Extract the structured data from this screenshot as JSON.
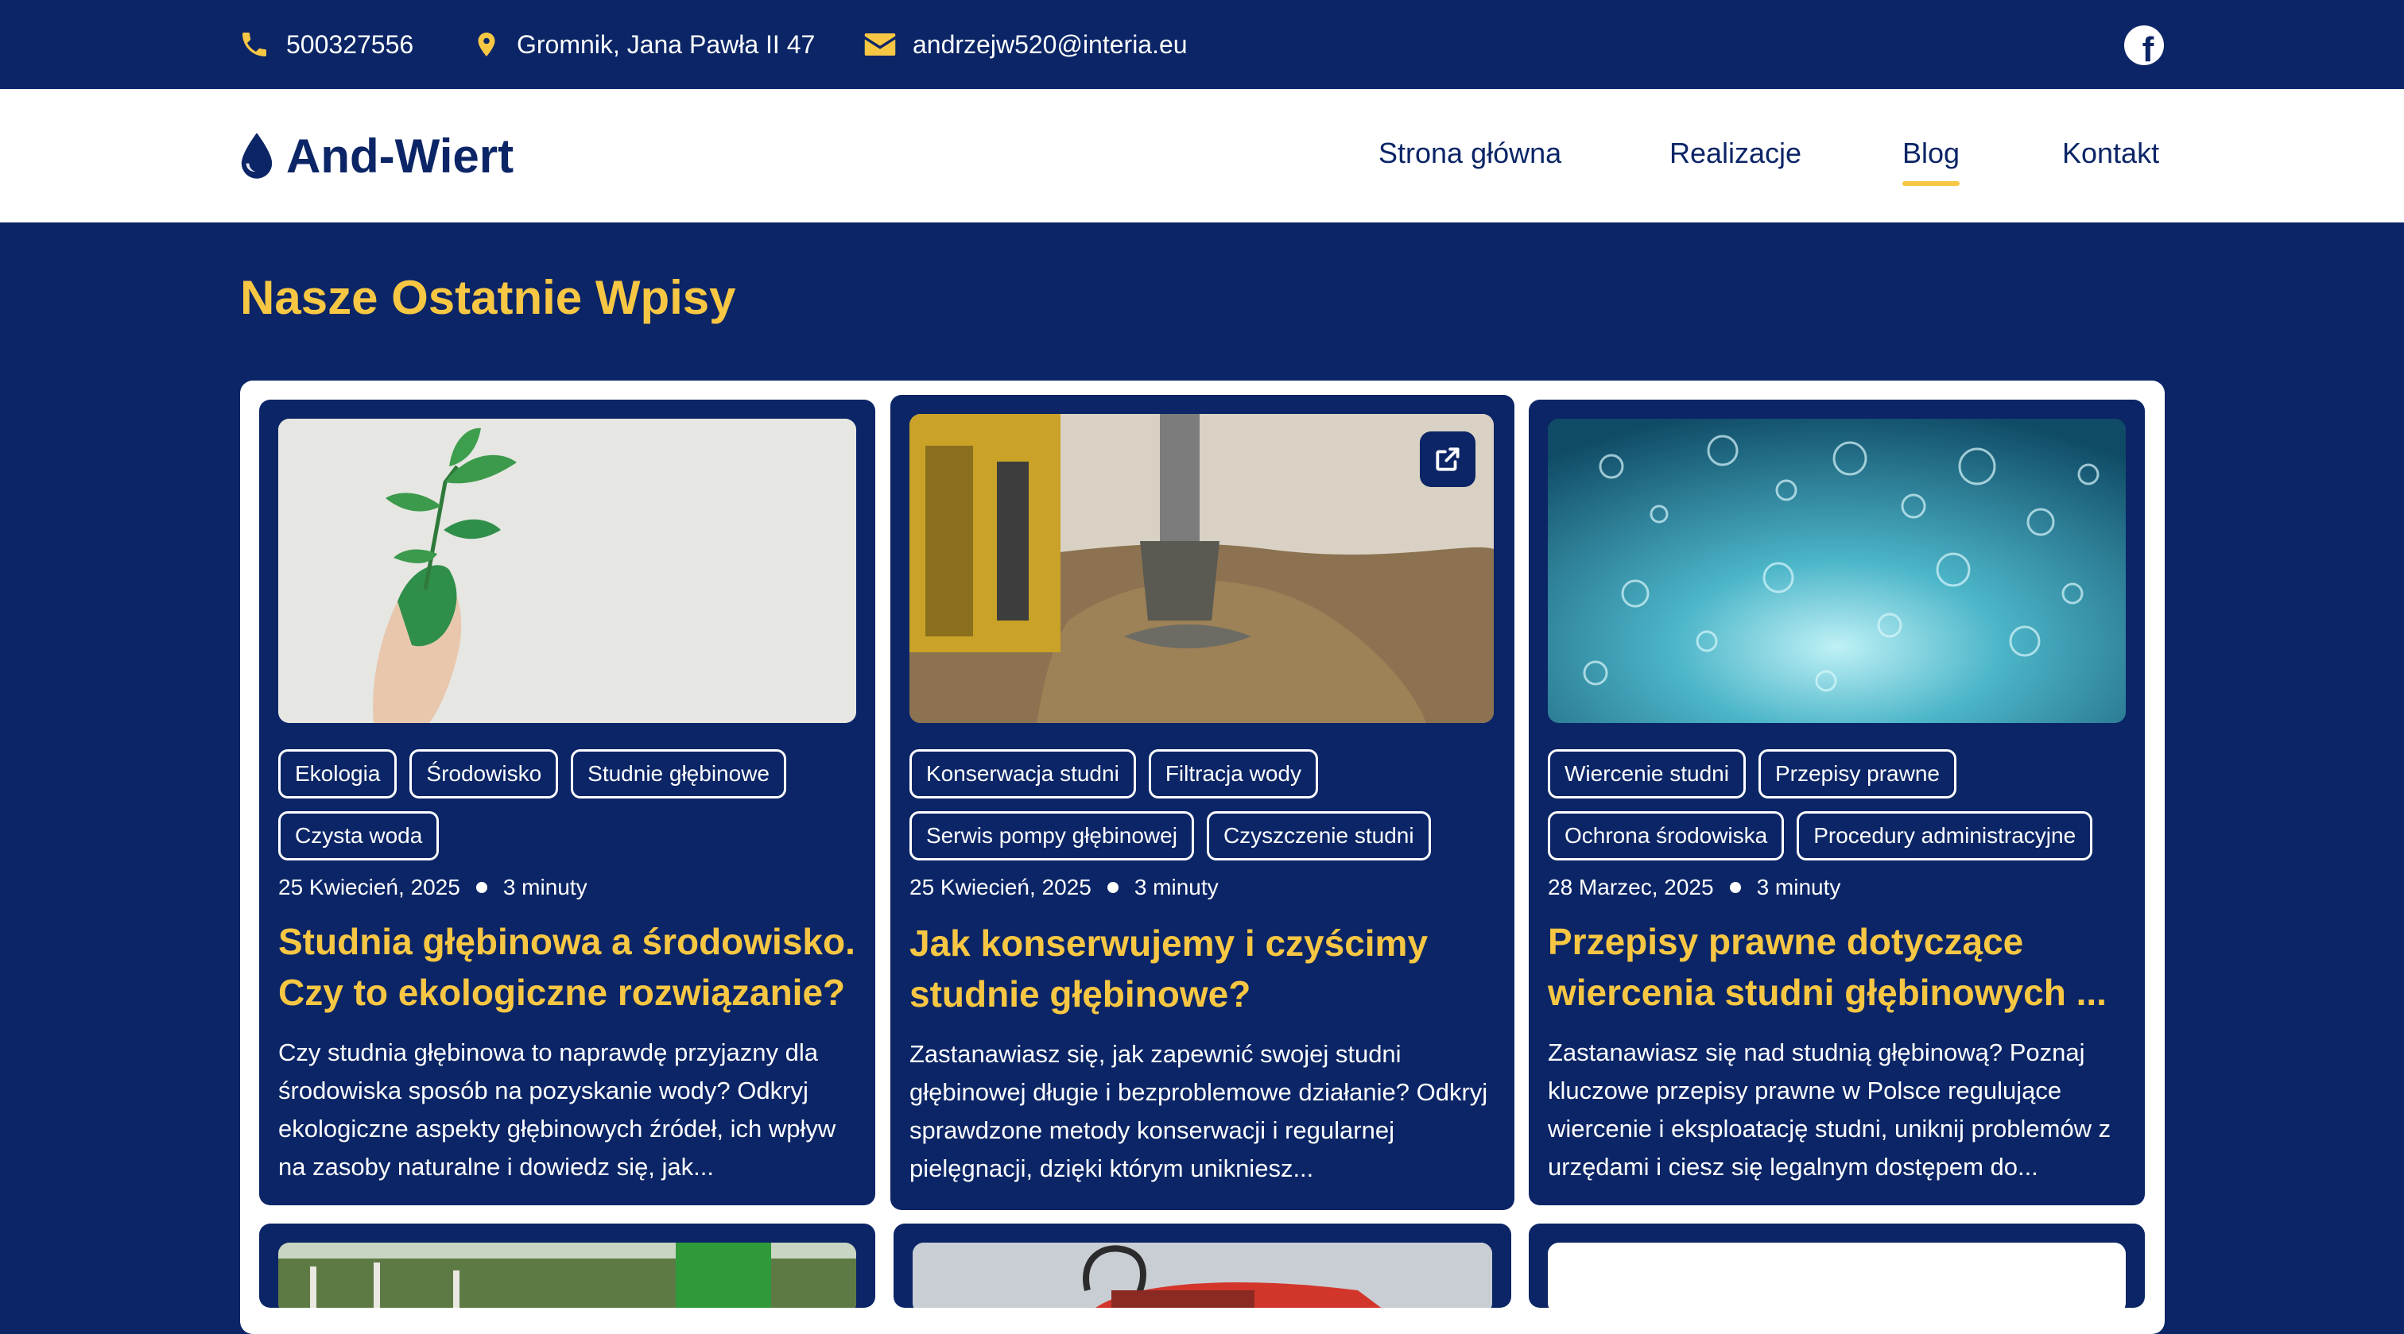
{
  "topbar": {
    "phone": "500327556",
    "address": "Gromnik, Jana Pawła II 47",
    "email": "andrzejw520@interia.eu",
    "social_icon": "facebook-icon"
  },
  "brand": {
    "name": "And-Wiert",
    "icon": "water-drop-icon"
  },
  "nav": {
    "items": [
      {
        "label": "Strona główna"
      },
      {
        "label": "Realizacje"
      },
      {
        "label": "Blog"
      },
      {
        "label": "Kontakt"
      }
    ],
    "active": "Blog"
  },
  "section": {
    "title": "Nasze Ostatnie Wpisy"
  },
  "posts": [
    {
      "tags": [
        "Ekologia",
        "Środowisko",
        "Studnie głębinowe",
        "Czysta woda"
      ],
      "date": "25 Kwiecień, 2025",
      "read_time": "3 minuty",
      "title": "Studnia głębinowa a środowisko. Czy to ekologiczne rozwiązanie?",
      "excerpt": "Czy studnia głębinowa to naprawdę przyjazny dla środowiska sposób na pozyskanie wody? Odkryj ekologiczne aspekty głębinowych źródeł, ich wpływ na zasoby naturalne i dowiedz się, jak..."
    },
    {
      "tags": [
        "Konserwacja studni",
        "Filtracja wody",
        "Serwis pompy głębinowej",
        "Czyszczenie studni"
      ],
      "date": "25 Kwiecień, 2025",
      "read_time": "3 minuty",
      "title": "Jak konserwujemy i czyścimy studnie głębinowe?",
      "excerpt": "Zastanawiasz się, jak zapewnić swojej studni głębinowej długie i bezproblemowe działanie? Odkryj sprawdzone metody konserwacji i regularnej pielęgnacji, dzięki którym unikniesz...",
      "open_icon": "external-link-icon"
    },
    {
      "tags": [
        "Wiercenie studni",
        "Przepisy prawne",
        "Ochrona środowiska",
        "Procedury administracyjne"
      ],
      "date": "28 Marzec, 2025",
      "read_time": "3 minuty",
      "title": "Przepisy prawne dotyczące wiercenia studni głębinowych ...",
      "excerpt": "Zastanawiasz się nad studnią głębinową? Poznaj kluczowe przepisy prawne w Polsce regulujące wiercenie i eksploatację studni, uniknij problemów z urzędami i ciesz się legalnym dostępem do..."
    }
  ],
  "colors": {
    "navy": "#0b2566",
    "accent": "#f7c744",
    "white": "#ffffff"
  }
}
